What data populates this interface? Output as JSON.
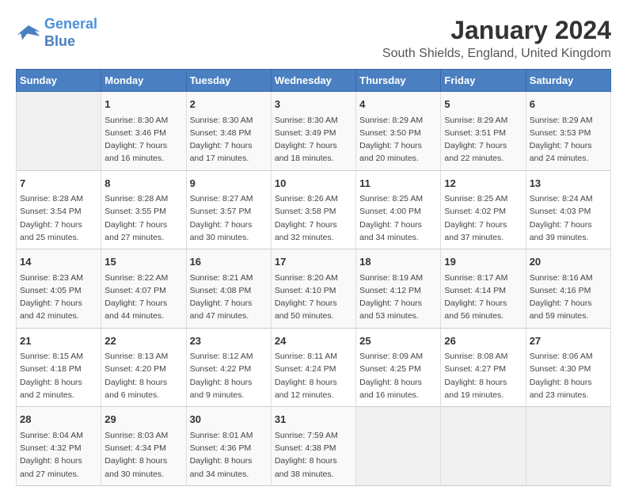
{
  "logo": {
    "line1": "General",
    "line2": "Blue"
  },
  "title": "January 2024",
  "subtitle": "South Shields, England, United Kingdom",
  "days_of_week": [
    "Sunday",
    "Monday",
    "Tuesday",
    "Wednesday",
    "Thursday",
    "Friday",
    "Saturday"
  ],
  "weeks": [
    [
      {
        "day": "",
        "info": ""
      },
      {
        "day": "1",
        "info": "Sunrise: 8:30 AM\nSunset: 3:46 PM\nDaylight: 7 hours\nand 16 minutes."
      },
      {
        "day": "2",
        "info": "Sunrise: 8:30 AM\nSunset: 3:48 PM\nDaylight: 7 hours\nand 17 minutes."
      },
      {
        "day": "3",
        "info": "Sunrise: 8:30 AM\nSunset: 3:49 PM\nDaylight: 7 hours\nand 18 minutes."
      },
      {
        "day": "4",
        "info": "Sunrise: 8:29 AM\nSunset: 3:50 PM\nDaylight: 7 hours\nand 20 minutes."
      },
      {
        "day": "5",
        "info": "Sunrise: 8:29 AM\nSunset: 3:51 PM\nDaylight: 7 hours\nand 22 minutes."
      },
      {
        "day": "6",
        "info": "Sunrise: 8:29 AM\nSunset: 3:53 PM\nDaylight: 7 hours\nand 24 minutes."
      }
    ],
    [
      {
        "day": "7",
        "info": "Sunrise: 8:28 AM\nSunset: 3:54 PM\nDaylight: 7 hours\nand 25 minutes."
      },
      {
        "day": "8",
        "info": "Sunrise: 8:28 AM\nSunset: 3:55 PM\nDaylight: 7 hours\nand 27 minutes."
      },
      {
        "day": "9",
        "info": "Sunrise: 8:27 AM\nSunset: 3:57 PM\nDaylight: 7 hours\nand 30 minutes."
      },
      {
        "day": "10",
        "info": "Sunrise: 8:26 AM\nSunset: 3:58 PM\nDaylight: 7 hours\nand 32 minutes."
      },
      {
        "day": "11",
        "info": "Sunrise: 8:25 AM\nSunset: 4:00 PM\nDaylight: 7 hours\nand 34 minutes."
      },
      {
        "day": "12",
        "info": "Sunrise: 8:25 AM\nSunset: 4:02 PM\nDaylight: 7 hours\nand 37 minutes."
      },
      {
        "day": "13",
        "info": "Sunrise: 8:24 AM\nSunset: 4:03 PM\nDaylight: 7 hours\nand 39 minutes."
      }
    ],
    [
      {
        "day": "14",
        "info": "Sunrise: 8:23 AM\nSunset: 4:05 PM\nDaylight: 7 hours\nand 42 minutes."
      },
      {
        "day": "15",
        "info": "Sunrise: 8:22 AM\nSunset: 4:07 PM\nDaylight: 7 hours\nand 44 minutes."
      },
      {
        "day": "16",
        "info": "Sunrise: 8:21 AM\nSunset: 4:08 PM\nDaylight: 7 hours\nand 47 minutes."
      },
      {
        "day": "17",
        "info": "Sunrise: 8:20 AM\nSunset: 4:10 PM\nDaylight: 7 hours\nand 50 minutes."
      },
      {
        "day": "18",
        "info": "Sunrise: 8:19 AM\nSunset: 4:12 PM\nDaylight: 7 hours\nand 53 minutes."
      },
      {
        "day": "19",
        "info": "Sunrise: 8:17 AM\nSunset: 4:14 PM\nDaylight: 7 hours\nand 56 minutes."
      },
      {
        "day": "20",
        "info": "Sunrise: 8:16 AM\nSunset: 4:16 PM\nDaylight: 7 hours\nand 59 minutes."
      }
    ],
    [
      {
        "day": "21",
        "info": "Sunrise: 8:15 AM\nSunset: 4:18 PM\nDaylight: 8 hours\nand 2 minutes."
      },
      {
        "day": "22",
        "info": "Sunrise: 8:13 AM\nSunset: 4:20 PM\nDaylight: 8 hours\nand 6 minutes."
      },
      {
        "day": "23",
        "info": "Sunrise: 8:12 AM\nSunset: 4:22 PM\nDaylight: 8 hours\nand 9 minutes."
      },
      {
        "day": "24",
        "info": "Sunrise: 8:11 AM\nSunset: 4:24 PM\nDaylight: 8 hours\nand 12 minutes."
      },
      {
        "day": "25",
        "info": "Sunrise: 8:09 AM\nSunset: 4:25 PM\nDaylight: 8 hours\nand 16 minutes."
      },
      {
        "day": "26",
        "info": "Sunrise: 8:08 AM\nSunset: 4:27 PM\nDaylight: 8 hours\nand 19 minutes."
      },
      {
        "day": "27",
        "info": "Sunrise: 8:06 AM\nSunset: 4:30 PM\nDaylight: 8 hours\nand 23 minutes."
      }
    ],
    [
      {
        "day": "28",
        "info": "Sunrise: 8:04 AM\nSunset: 4:32 PM\nDaylight: 8 hours\nand 27 minutes."
      },
      {
        "day": "29",
        "info": "Sunrise: 8:03 AM\nSunset: 4:34 PM\nDaylight: 8 hours\nand 30 minutes."
      },
      {
        "day": "30",
        "info": "Sunrise: 8:01 AM\nSunset: 4:36 PM\nDaylight: 8 hours\nand 34 minutes."
      },
      {
        "day": "31",
        "info": "Sunrise: 7:59 AM\nSunset: 4:38 PM\nDaylight: 8 hours\nand 38 minutes."
      },
      {
        "day": "",
        "info": ""
      },
      {
        "day": "",
        "info": ""
      },
      {
        "day": "",
        "info": ""
      }
    ]
  ]
}
